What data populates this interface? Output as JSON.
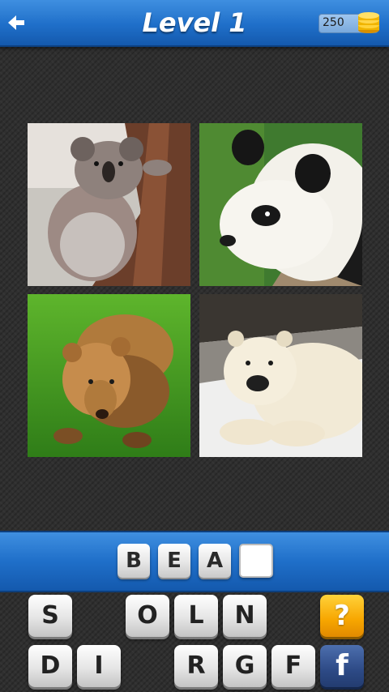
{
  "header": {
    "title": "Level 1",
    "coins": "250",
    "back_icon": "back-arrow-icon",
    "coin_icon": "coin-stack-icon"
  },
  "photos": [
    {
      "subject": "koala"
    },
    {
      "subject": "giant panda"
    },
    {
      "subject": "brown bear"
    },
    {
      "subject": "polar bear"
    }
  ],
  "answer": {
    "letters": [
      "B",
      "E",
      "A",
      ""
    ]
  },
  "keyboard": {
    "row1": [
      "S",
      "",
      "",
      "O",
      "L",
      "N"
    ],
    "row2": [
      "D",
      "I",
      "",
      "R",
      "G",
      "F"
    ],
    "hint_label": "?",
    "share_label": "f"
  },
  "colors": {
    "header_blue": "#1f6fc9",
    "hint_orange": "#f7a600",
    "facebook_blue": "#2d4a86"
  }
}
